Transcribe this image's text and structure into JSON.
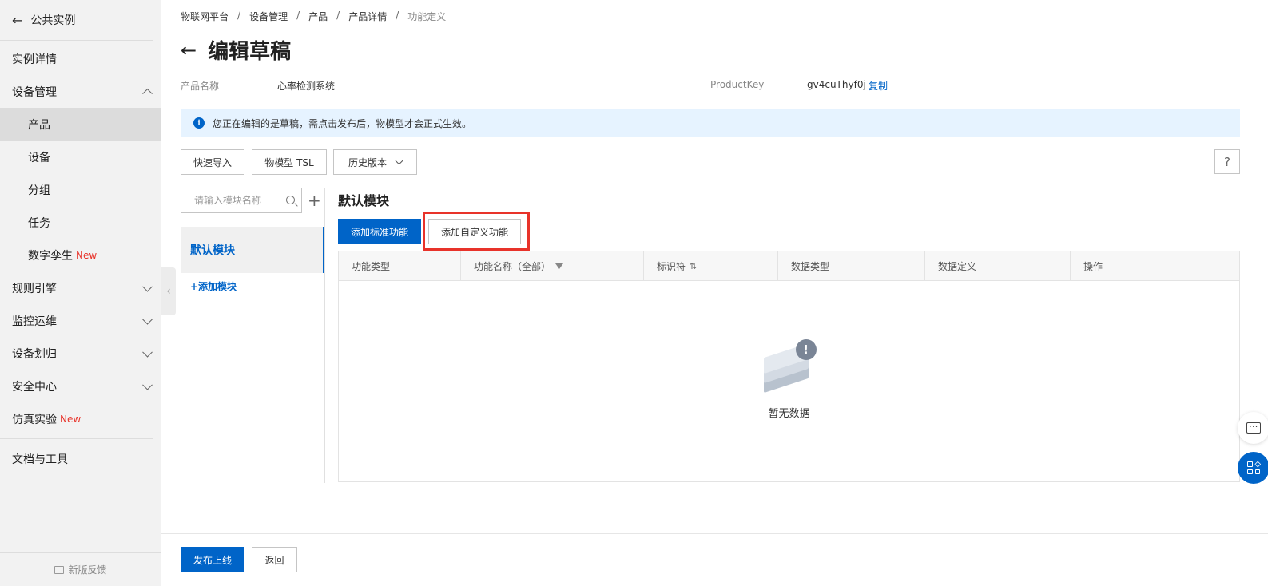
{
  "sidebar": {
    "top_label": "公共实例",
    "items": [
      {
        "label": "实例详情"
      },
      {
        "label": "设备管理"
      },
      {
        "label": "产品"
      },
      {
        "label": "设备"
      },
      {
        "label": "分组"
      },
      {
        "label": "任务"
      },
      {
        "label": "数字孪生",
        "badge": "New"
      },
      {
        "label": "规则引擎"
      },
      {
        "label": "监控运维"
      },
      {
        "label": "设备划归"
      },
      {
        "label": "安全中心"
      },
      {
        "label": "仿真实验",
        "badge": "New"
      },
      {
        "label": "文档与工具"
      }
    ],
    "feedback": "新版反馈"
  },
  "breadcrumb": [
    "物联网平台",
    "设备管理",
    "产品",
    "产品详情",
    "功能定义"
  ],
  "breadcrumb_sep": "/",
  "page": {
    "back_arrow": "←",
    "title": "编辑草稿",
    "product_name_label": "产品名称",
    "product_name": "心率检测系统",
    "product_key_label": "ProductKey",
    "product_key": "gv4cuThyf0j",
    "copy_label": "复制"
  },
  "notice": {
    "icon": "info-icon",
    "text": "您正在编辑的是草稿，需点击发布后，物模型才会正式生效。"
  },
  "toolbar": {
    "quick_import": "快速导入",
    "tsl": "物模型 TSL",
    "history": "历史版本",
    "help": "?"
  },
  "modules": {
    "search_placeholder": "请输入模块名称",
    "add_icon": "+",
    "selected": "默认模块",
    "add_label": "+添加模块"
  },
  "content": {
    "section_title": "默认模块",
    "add_standard": "添加标准功能",
    "add_custom": "添加自定义功能",
    "columns": [
      "功能类型",
      "功能名称（全部）",
      "标识符",
      "数据类型",
      "数据定义",
      "操作"
    ],
    "empty_text": "暂无数据"
  },
  "footer": {
    "publish": "发布上线",
    "back": "返回"
  },
  "colors": {
    "primary": "#0064c8",
    "new_badge": "#e8332a",
    "highlight": "#e8332a",
    "notice_bg": "#e6f3ff"
  }
}
